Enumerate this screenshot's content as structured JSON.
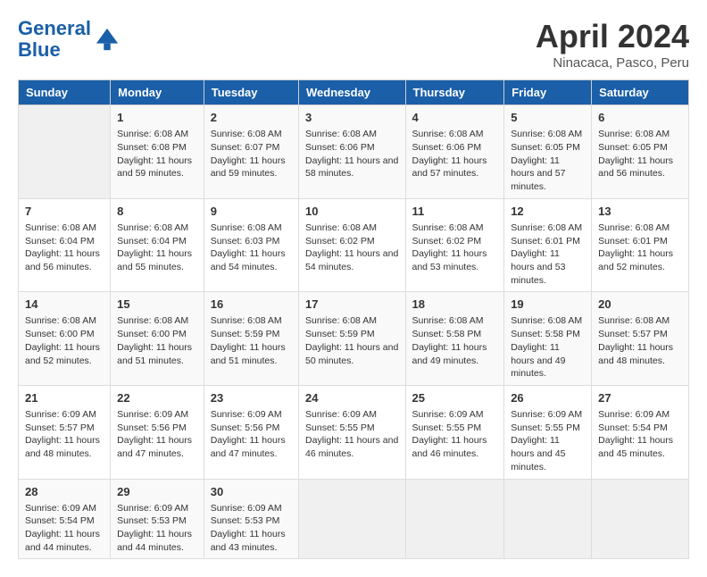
{
  "logo": {
    "line1": "General",
    "line2": "Blue"
  },
  "title": "April 2024",
  "subtitle": "Ninacaca, Pasco, Peru",
  "days_of_week": [
    "Sunday",
    "Monday",
    "Tuesday",
    "Wednesday",
    "Thursday",
    "Friday",
    "Saturday"
  ],
  "weeks": [
    [
      {
        "day": "",
        "sunrise": "",
        "sunset": "",
        "daylight": ""
      },
      {
        "day": "1",
        "sunrise": "Sunrise: 6:08 AM",
        "sunset": "Sunset: 6:08 PM",
        "daylight": "Daylight: 11 hours and 59 minutes."
      },
      {
        "day": "2",
        "sunrise": "Sunrise: 6:08 AM",
        "sunset": "Sunset: 6:07 PM",
        "daylight": "Daylight: 11 hours and 59 minutes."
      },
      {
        "day": "3",
        "sunrise": "Sunrise: 6:08 AM",
        "sunset": "Sunset: 6:06 PM",
        "daylight": "Daylight: 11 hours and 58 minutes."
      },
      {
        "day": "4",
        "sunrise": "Sunrise: 6:08 AM",
        "sunset": "Sunset: 6:06 PM",
        "daylight": "Daylight: 11 hours and 57 minutes."
      },
      {
        "day": "5",
        "sunrise": "Sunrise: 6:08 AM",
        "sunset": "Sunset: 6:05 PM",
        "daylight": "Daylight: 11 hours and 57 minutes."
      },
      {
        "day": "6",
        "sunrise": "Sunrise: 6:08 AM",
        "sunset": "Sunset: 6:05 PM",
        "daylight": "Daylight: 11 hours and 56 minutes."
      }
    ],
    [
      {
        "day": "7",
        "sunrise": "Sunrise: 6:08 AM",
        "sunset": "Sunset: 6:04 PM",
        "daylight": "Daylight: 11 hours and 56 minutes."
      },
      {
        "day": "8",
        "sunrise": "Sunrise: 6:08 AM",
        "sunset": "Sunset: 6:04 PM",
        "daylight": "Daylight: 11 hours and 55 minutes."
      },
      {
        "day": "9",
        "sunrise": "Sunrise: 6:08 AM",
        "sunset": "Sunset: 6:03 PM",
        "daylight": "Daylight: 11 hours and 54 minutes."
      },
      {
        "day": "10",
        "sunrise": "Sunrise: 6:08 AM",
        "sunset": "Sunset: 6:02 PM",
        "daylight": "Daylight: 11 hours and 54 minutes."
      },
      {
        "day": "11",
        "sunrise": "Sunrise: 6:08 AM",
        "sunset": "Sunset: 6:02 PM",
        "daylight": "Daylight: 11 hours and 53 minutes."
      },
      {
        "day": "12",
        "sunrise": "Sunrise: 6:08 AM",
        "sunset": "Sunset: 6:01 PM",
        "daylight": "Daylight: 11 hours and 53 minutes."
      },
      {
        "day": "13",
        "sunrise": "Sunrise: 6:08 AM",
        "sunset": "Sunset: 6:01 PM",
        "daylight": "Daylight: 11 hours and 52 minutes."
      }
    ],
    [
      {
        "day": "14",
        "sunrise": "Sunrise: 6:08 AM",
        "sunset": "Sunset: 6:00 PM",
        "daylight": "Daylight: 11 hours and 52 minutes."
      },
      {
        "day": "15",
        "sunrise": "Sunrise: 6:08 AM",
        "sunset": "Sunset: 6:00 PM",
        "daylight": "Daylight: 11 hours and 51 minutes."
      },
      {
        "day": "16",
        "sunrise": "Sunrise: 6:08 AM",
        "sunset": "Sunset: 5:59 PM",
        "daylight": "Daylight: 11 hours and 51 minutes."
      },
      {
        "day": "17",
        "sunrise": "Sunrise: 6:08 AM",
        "sunset": "Sunset: 5:59 PM",
        "daylight": "Daylight: 11 hours and 50 minutes."
      },
      {
        "day": "18",
        "sunrise": "Sunrise: 6:08 AM",
        "sunset": "Sunset: 5:58 PM",
        "daylight": "Daylight: 11 hours and 49 minutes."
      },
      {
        "day": "19",
        "sunrise": "Sunrise: 6:08 AM",
        "sunset": "Sunset: 5:58 PM",
        "daylight": "Daylight: 11 hours and 49 minutes."
      },
      {
        "day": "20",
        "sunrise": "Sunrise: 6:08 AM",
        "sunset": "Sunset: 5:57 PM",
        "daylight": "Daylight: 11 hours and 48 minutes."
      }
    ],
    [
      {
        "day": "21",
        "sunrise": "Sunrise: 6:09 AM",
        "sunset": "Sunset: 5:57 PM",
        "daylight": "Daylight: 11 hours and 48 minutes."
      },
      {
        "day": "22",
        "sunrise": "Sunrise: 6:09 AM",
        "sunset": "Sunset: 5:56 PM",
        "daylight": "Daylight: 11 hours and 47 minutes."
      },
      {
        "day": "23",
        "sunrise": "Sunrise: 6:09 AM",
        "sunset": "Sunset: 5:56 PM",
        "daylight": "Daylight: 11 hours and 47 minutes."
      },
      {
        "day": "24",
        "sunrise": "Sunrise: 6:09 AM",
        "sunset": "Sunset: 5:55 PM",
        "daylight": "Daylight: 11 hours and 46 minutes."
      },
      {
        "day": "25",
        "sunrise": "Sunrise: 6:09 AM",
        "sunset": "Sunset: 5:55 PM",
        "daylight": "Daylight: 11 hours and 46 minutes."
      },
      {
        "day": "26",
        "sunrise": "Sunrise: 6:09 AM",
        "sunset": "Sunset: 5:55 PM",
        "daylight": "Daylight: 11 hours and 45 minutes."
      },
      {
        "day": "27",
        "sunrise": "Sunrise: 6:09 AM",
        "sunset": "Sunset: 5:54 PM",
        "daylight": "Daylight: 11 hours and 45 minutes."
      }
    ],
    [
      {
        "day": "28",
        "sunrise": "Sunrise: 6:09 AM",
        "sunset": "Sunset: 5:54 PM",
        "daylight": "Daylight: 11 hours and 44 minutes."
      },
      {
        "day": "29",
        "sunrise": "Sunrise: 6:09 AM",
        "sunset": "Sunset: 5:53 PM",
        "daylight": "Daylight: 11 hours and 44 minutes."
      },
      {
        "day": "30",
        "sunrise": "Sunrise: 6:09 AM",
        "sunset": "Sunset: 5:53 PM",
        "daylight": "Daylight: 11 hours and 43 minutes."
      },
      {
        "day": "",
        "sunrise": "",
        "sunset": "",
        "daylight": ""
      },
      {
        "day": "",
        "sunrise": "",
        "sunset": "",
        "daylight": ""
      },
      {
        "day": "",
        "sunrise": "",
        "sunset": "",
        "daylight": ""
      },
      {
        "day": "",
        "sunrise": "",
        "sunset": "",
        "daylight": ""
      }
    ]
  ]
}
